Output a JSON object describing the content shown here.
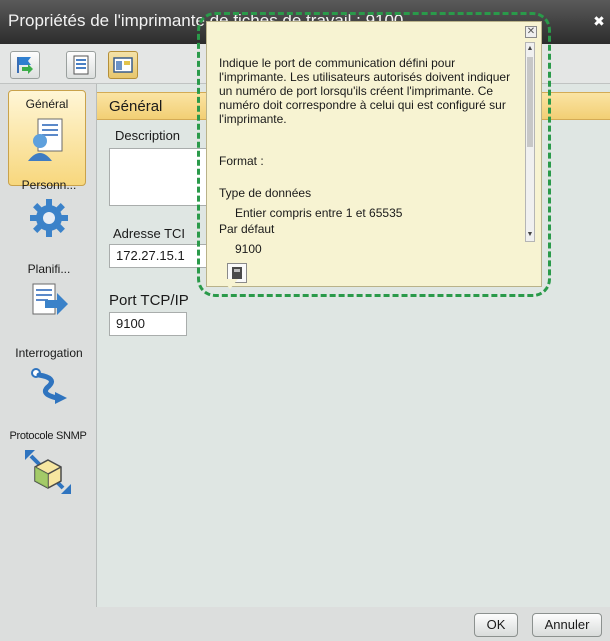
{
  "window": {
    "title": "Propriétés de l'imprimante de fiches de travail : 9100",
    "close_glyph": "✖"
  },
  "toolbar": {
    "buttons": [
      {
        "name": "flag-arrow-icon"
      },
      {
        "name": "document-list-icon"
      },
      {
        "name": "window-panel-icon"
      }
    ]
  },
  "sidebar": {
    "items": [
      {
        "label": "Général",
        "icon": "user-document-icon",
        "active": true
      },
      {
        "label": "Personn...",
        "icon": "gear-icon"
      },
      {
        "label": "Planifi...",
        "icon": "schedule-arrow-icon"
      },
      {
        "label": "Interrogation",
        "icon": "path-arrow-icon"
      },
      {
        "label": "Protocole SNMP",
        "icon": "network-cube-icon"
      }
    ]
  },
  "content": {
    "header": "Général",
    "description_label": "Description",
    "description_value": "",
    "address_label": "Adresse TCI",
    "address_value": "172.27.15.1",
    "port_label": "Port TCP/IP",
    "port_value": "9100"
  },
  "footer": {
    "ok_label": "OK",
    "cancel_label": "Annuler"
  },
  "tooltip": {
    "close_glyph": "✕",
    "description": "Indique le port de communication défini pour l'imprimante. Les utilisateurs autorisés doivent indiquer un numéro de port lorsqu'ils créent l'imprimante. Ce numéro doit correspondre à celui qui est configuré sur l'imprimante.",
    "format_label": "Format :",
    "data_type_label": "Type de données",
    "data_type_value": "Entier compris entre 1 et 65535",
    "default_label": "Par défaut",
    "default_value": "9100"
  },
  "colors": {
    "highlight_border": "#2a9a4a",
    "header_gold": "#f2cf74",
    "titlebar": "#3a3a3a"
  }
}
